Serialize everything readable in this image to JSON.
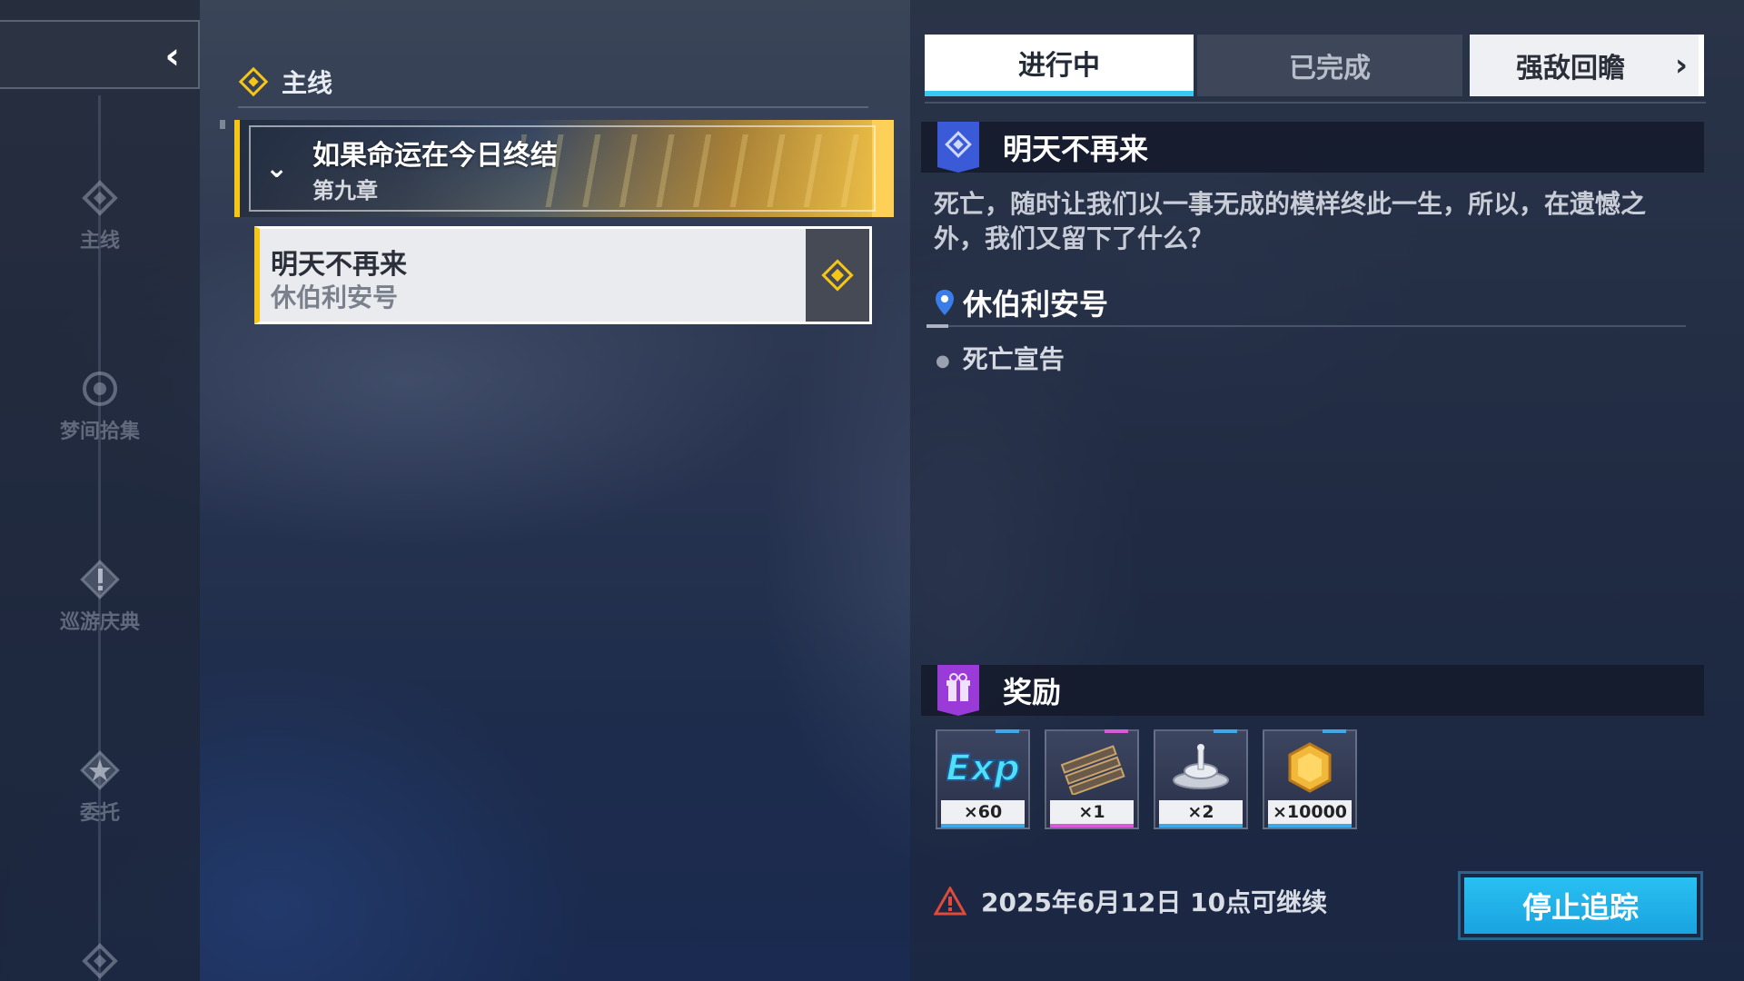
{
  "sidebar": {
    "back_icon": "chevron-left-icon",
    "items": [
      {
        "label": "主线",
        "icon": "diamond-icon"
      },
      {
        "label": "梦间拾集",
        "icon": "target-icon"
      },
      {
        "label": "巡游庆典",
        "icon": "exclamation-icon"
      },
      {
        "label": "委托",
        "icon": "star-icon"
      },
      {
        "label": "",
        "icon": "diamond-icon"
      }
    ]
  },
  "quest_list": {
    "section_title": "主线",
    "chapter": {
      "title": "如果命运在今日终结",
      "subtitle": "第九章"
    },
    "quest": {
      "title": "明天不再来",
      "subtitle": "休伯利安号"
    }
  },
  "tabs": {
    "in_progress": "进行中",
    "completed": "已完成",
    "boss_review": "强敌回瞻"
  },
  "detail": {
    "quest_title": "明天不再来",
    "description": "死亡，随时让我们以一事无成的模样终此一生，所以，在遗憾之外，我们又留下了什么？",
    "location": "休伯利安号",
    "objective": "死亡宣告",
    "rewards_title": "奖励",
    "rewards": [
      {
        "icon": "exp-icon",
        "count": "×60"
      },
      {
        "icon": "material-bars-icon",
        "count": "×1"
      },
      {
        "icon": "water-splash-icon",
        "count": "×2"
      },
      {
        "icon": "gold-coin-icon",
        "count": "×10000"
      }
    ],
    "notice": "2025年6月12日 10点可继续",
    "stop_button": "停止追踪"
  },
  "colors": {
    "accent_yellow": "#f5c518",
    "accent_cyan": "#37c9f2",
    "quest_badge_blue": "#3a5ad8",
    "reward_badge_purple": "#9a3ad8",
    "warning_red": "#e04a3a"
  }
}
